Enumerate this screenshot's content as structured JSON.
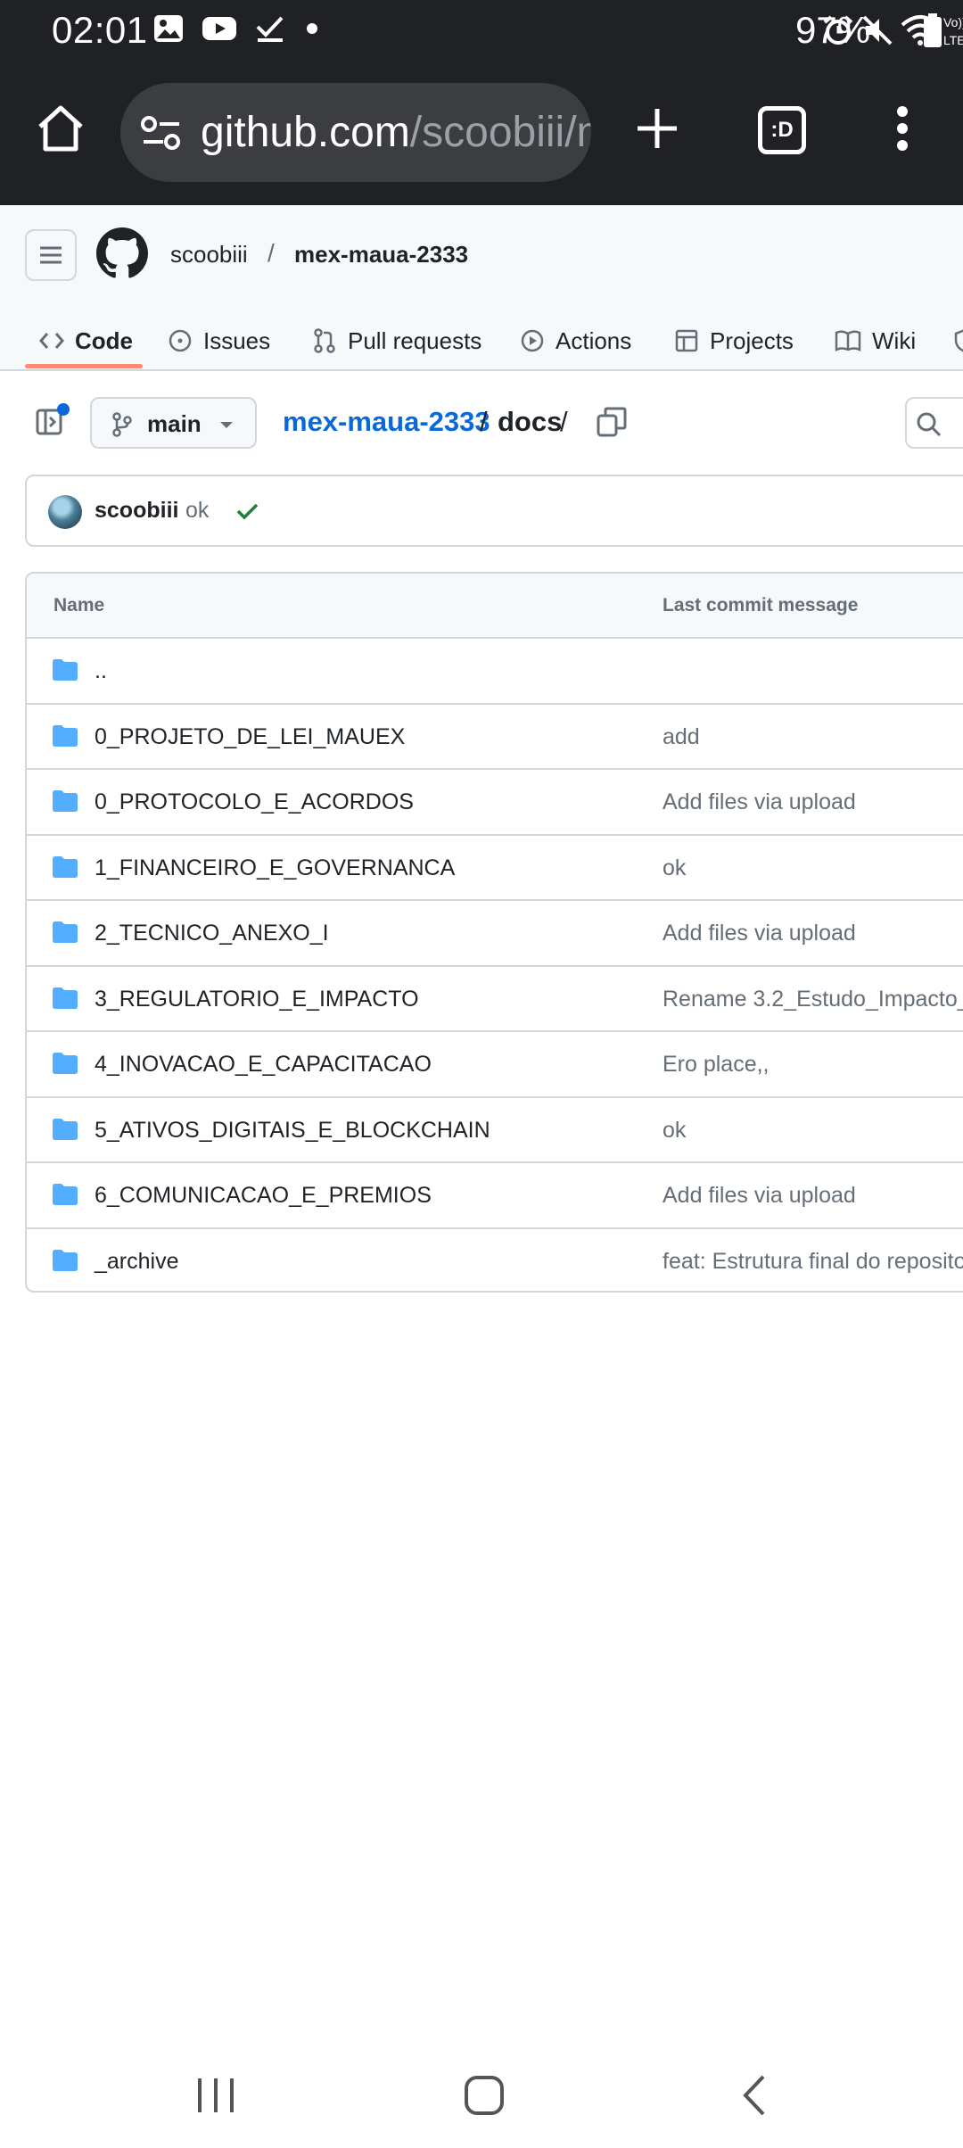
{
  "status_bar": {
    "time": "02:01",
    "battery": "97%",
    "left_icons": [
      "image-icon",
      "youtube-icon",
      "check-icon",
      "dot-icon"
    ],
    "right_icons": [
      "alarm-icon",
      "mute-icon",
      "wifi-icon",
      "volte-icon",
      "signal-icon",
      "battery-icon"
    ]
  },
  "browser": {
    "url_host": "github.com",
    "url_path": "/scoobiii/m",
    "tab_switcher_label": ":D"
  },
  "repo": {
    "owner": "scoobiii",
    "separator": "/",
    "name": "mex-maua-2333"
  },
  "tabs": [
    {
      "label": "Code",
      "icon": "code-icon",
      "active": true
    },
    {
      "label": "Issues",
      "icon": "issue-icon"
    },
    {
      "label": "Pull requests",
      "icon": "pull-request-icon"
    },
    {
      "label": "Actions",
      "icon": "play-icon"
    },
    {
      "label": "Projects",
      "icon": "table-icon"
    },
    {
      "label": "Wiki",
      "icon": "book-icon"
    }
  ],
  "toolbar": {
    "branch": "main",
    "breadcrumb_repo": "mex-maua-2333",
    "breadcrumb_sep": "/",
    "breadcrumb_dir": "docs",
    "breadcrumb_trailing_sep": "/"
  },
  "commit": {
    "author": "scoobiii",
    "message": "ok",
    "status": "success"
  },
  "table": {
    "columns": [
      "Name",
      "Last commit message"
    ],
    "rows": [
      {
        "name": "..",
        "message": ""
      },
      {
        "name": "0_PROJETO_DE_LEI_MAUEX",
        "message": "add"
      },
      {
        "name": "0_PROTOCOLO_E_ACORDOS",
        "message": "Add files via upload"
      },
      {
        "name": "1_FINANCEIRO_E_GOVERNANCA",
        "message": "ok"
      },
      {
        "name": "2_TECNICO_ANEXO_I",
        "message": "Add files via upload"
      },
      {
        "name": "3_REGULATORIO_E_IMPACTO",
        "message": "Rename 3.2_Estudo_Impacto_"
      },
      {
        "name": "4_INOVACAO_E_CAPACITACAO",
        "message": "Ero place,,"
      },
      {
        "name": "5_ATIVOS_DIGITAIS_E_BLOCKCHAIN",
        "message": "ok"
      },
      {
        "name": "6_COMUNICACAO_E_PREMIOS",
        "message": "Add files via upload"
      },
      {
        "name": "_archive",
        "message": "feat: Estrutura final do reposito"
      }
    ]
  },
  "colors": {
    "link": "#0969da",
    "folder": "#54aeff",
    "active_tab_underline": "#fd8c73",
    "success": "#1a7f37"
  }
}
